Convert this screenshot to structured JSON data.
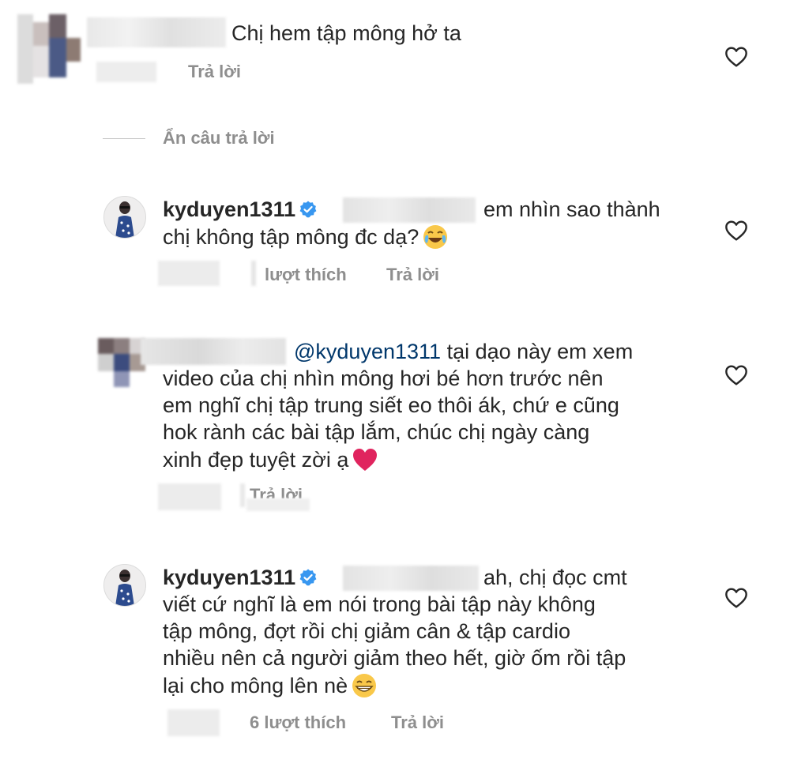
{
  "comment1": {
    "text": "Chị hem tập mông hở ta",
    "reply_label": "Trả lời"
  },
  "hide_replies_label": "Ẩn câu trả lời",
  "reply1": {
    "username": "kyduyen1311",
    "text_line1": "em nhìn sao thành",
    "text_line2": "chị không tập mông đc dạ?",
    "likes_label": "lượt thích",
    "reply_label": "Trả lời"
  },
  "reply2": {
    "mention": "@kyduyen1311",
    "text_line1": "tại dạo này em xem",
    "text_line2": "video của chị nhìn mông hơi bé hơn trước nên",
    "text_line3": "em nghĩ chị tập trung siết eo thôi ák, chứ e cũng",
    "text_line4": "hok rành các bài tập lắm, chúc chị ngày càng",
    "text_line5": "xinh đẹp tuyệt zời ạ",
    "reply_label": "Trả lời"
  },
  "reply3": {
    "username": "kyduyen1311",
    "text_line1": "ah, chị đọc cmt",
    "text_line2": "viết cứ nghĩ là em nói trong bài tập này không",
    "text_line3": "tập mông, đợt rồi chị giảm cân & tập cardio",
    "text_line4": "nhiều nên cả người giảm theo hết, giờ ốm rồi tập",
    "text_line5": "lại cho mông lên nè",
    "likes_label": "6 lượt thích",
    "reply_label": "Trả lời"
  },
  "icons": {
    "like": "heart-outline-icon",
    "verified": "verified-badge-icon",
    "emoji_laugh": "face-with-tears-of-joy",
    "emoji_heart": "red-heart",
    "emoji_grin": "grinning-face"
  },
  "colors": {
    "text": "#262626",
    "secondary": "#8e8e8e",
    "mention": "#00376b",
    "verified": "#3897f0"
  }
}
